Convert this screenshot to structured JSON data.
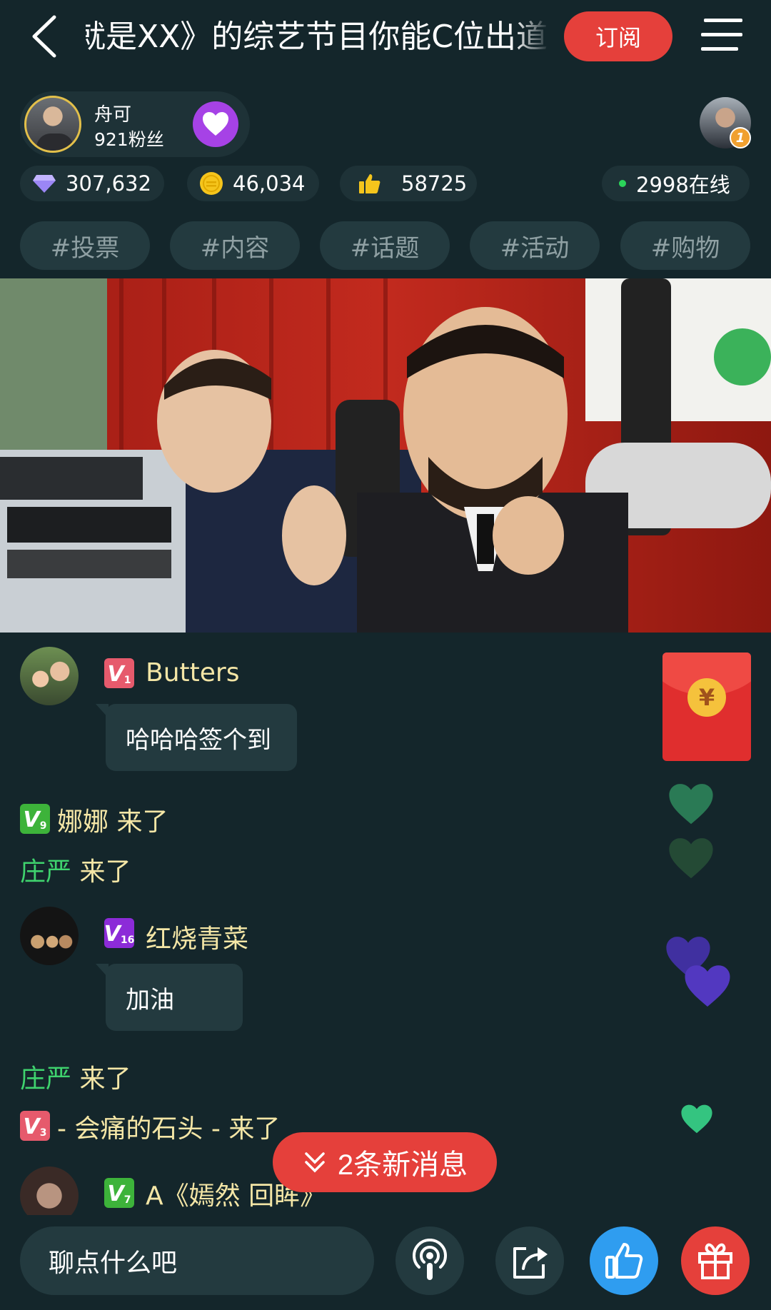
{
  "header": {
    "title": "就是XX》的综艺节目你能C位出道",
    "subscribe_label": "订阅"
  },
  "host": {
    "name": "舟可",
    "fans": "921粉丝"
  },
  "top_viewer": {
    "rank": "1"
  },
  "stats": {
    "diamonds": "307,632",
    "coins": "46,034",
    "likes": "58725",
    "online": "2998在线"
  },
  "tags": [
    "#投票",
    "#内容",
    "#话题",
    "#活动",
    "#购物"
  ],
  "chat": {
    "messages": [
      {
        "user": "Butters",
        "level": "1",
        "text": "哈哈哈签个到"
      },
      {
        "user": "红烧青菜",
        "level": "16",
        "text": "加油"
      }
    ],
    "joins": [
      {
        "user": "娜娜",
        "level": "9",
        "action": "来了"
      },
      {
        "user": "庄严",
        "action": "来了"
      },
      {
        "user": "庄严",
        "action": "来了"
      },
      {
        "user": "- 会痛的石头 -",
        "level": "3",
        "action": "来了"
      }
    ],
    "partial": {
      "user": "A《嫣然 回眸》",
      "level": "7"
    }
  },
  "new_messages_label": "2条新消息",
  "input": {
    "placeholder": "聊点什么吧"
  },
  "colors": {
    "background": "#14262b",
    "accent_red": "#e5403b",
    "username": "#f4e6a6",
    "join_green": "#3fd36e",
    "like_blue": "#2f9df0"
  }
}
